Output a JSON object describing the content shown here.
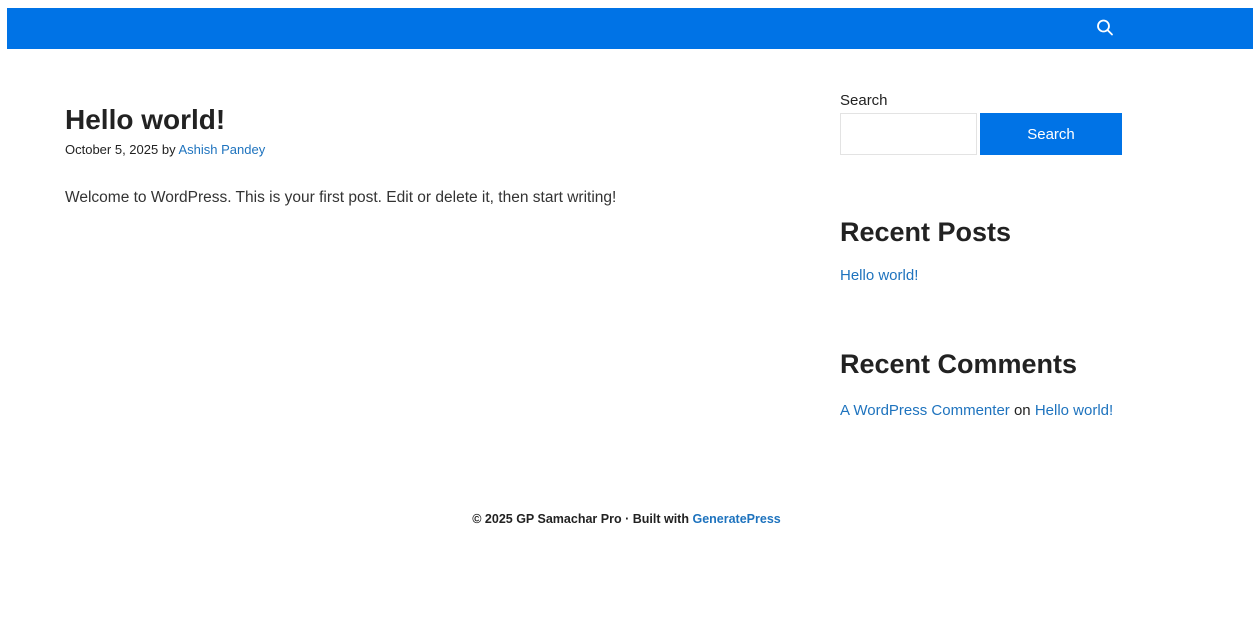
{
  "header": {
    "search_icon": "search-icon",
    "accent_color": "#0073e6"
  },
  "post": {
    "title": "Hello world!",
    "date": "October 5, 2025",
    "by": "by",
    "author": "Ashish Pandey",
    "content": "Welcome to WordPress. This is your first post. Edit or delete it, then start writing!"
  },
  "sidebar": {
    "search": {
      "label": "Search",
      "input_value": "",
      "button_label": "Search"
    },
    "recent_posts": {
      "title": "Recent Posts",
      "items": [
        {
          "label": "Hello world!"
        }
      ]
    },
    "recent_comments": {
      "title": "Recent Comments",
      "items": [
        {
          "author": "A WordPress Commenter",
          "on": "on",
          "post": "Hello world!"
        }
      ]
    }
  },
  "footer": {
    "copyright": "© 2025 GP Samachar Pro",
    "separator": "·",
    "built_with": "Built with",
    "theme": "GeneratePress"
  }
}
